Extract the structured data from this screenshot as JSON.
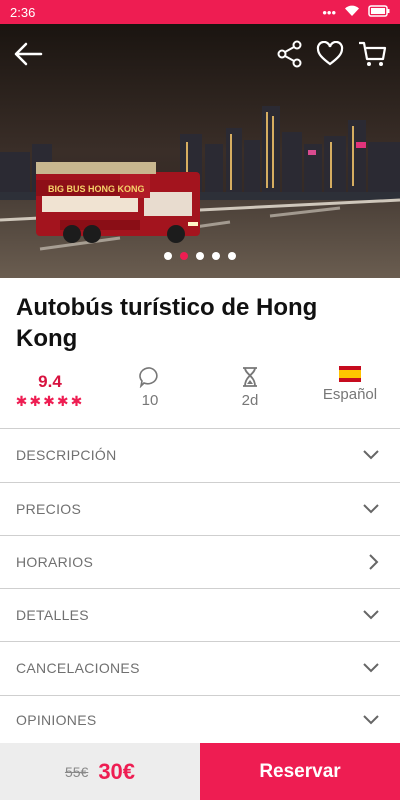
{
  "status": {
    "time": "2:36",
    "icons": [
      "dots-icon",
      "wifi-icon",
      "battery-icon"
    ]
  },
  "hero": {
    "photo_alt": "Autobús turístico de Hong Kong",
    "bus_banner": "BIG BUS HONG KONG",
    "carousel_total": 5,
    "carousel_active_index": 1
  },
  "title": "Autobús turístico de Hong Kong",
  "stats": {
    "rating": "9.4",
    "stars": "✱✱✱✱✱",
    "comments": "10",
    "duration": "2d",
    "language": "Español"
  },
  "sections": [
    {
      "label": "DESCRIPCIÓN",
      "icon": "chevron-down-icon"
    },
    {
      "label": "PRECIOS",
      "icon": "chevron-down-icon"
    },
    {
      "label": "HORARIOS",
      "icon": "chevron-right-icon"
    },
    {
      "label": "DETALLES",
      "icon": "chevron-down-icon"
    },
    {
      "label": "CANCELACIONES",
      "icon": "chevron-down-icon"
    },
    {
      "label": "OPINIONES",
      "icon": "chevron-down-icon"
    }
  ],
  "footer": {
    "old_price": "55€",
    "new_price": "30€",
    "cta": "Reservar"
  },
  "colors": {
    "accent": "#ee1d52",
    "rating": "#d8123f"
  }
}
